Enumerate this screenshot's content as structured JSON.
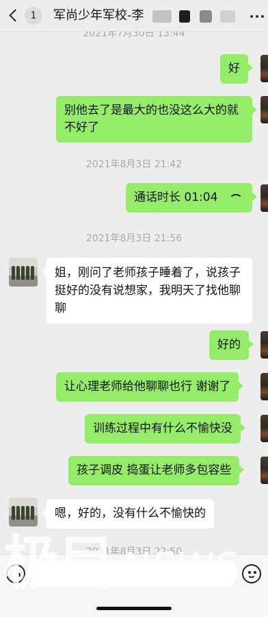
{
  "header": {
    "back_label": "<",
    "unread_count": "1",
    "title": "军尚少年军校-李"
  },
  "messages": [
    {
      "type": "time",
      "text": "2021年7月30日 13:44"
    },
    {
      "type": "out",
      "text": "好"
    },
    {
      "type": "out",
      "text": "别他去了是最大的也没这么大的就不好了"
    },
    {
      "type": "time",
      "text": "2021年8月3日 21:42"
    },
    {
      "type": "out-call",
      "text": "通话时长 01:04"
    },
    {
      "type": "time",
      "text": "2021年8月3日 21:56"
    },
    {
      "type": "in",
      "text": "姐，刚问了老师孩子睡着了，说孩子挺好的没有说想家，我明天了找他聊聊"
    },
    {
      "type": "out",
      "text": "好的"
    },
    {
      "type": "out",
      "text": "让心理老师给他聊聊也行 谢谢了"
    },
    {
      "type": "out",
      "text": "训练过程中有什么不愉快没"
    },
    {
      "type": "out",
      "text": "孩子调皮 捣蛋让老师多包容些"
    },
    {
      "type": "in",
      "text": "嗯，好的，没有什么不愉快的"
    },
    {
      "type": "time",
      "text": "2021年8月3日 22:50"
    }
  ],
  "watermark": {
    "cn": "极目",
    "en": "NEWS"
  },
  "colors": {
    "outgoing": "#95ec69",
    "incoming": "#ffffff",
    "background": "#ededed"
  }
}
